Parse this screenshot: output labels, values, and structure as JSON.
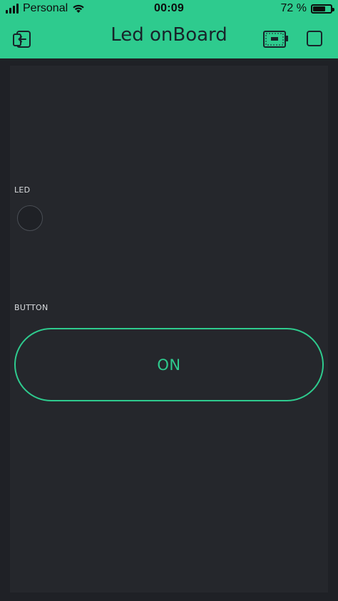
{
  "status_bar": {
    "carrier": "Personal",
    "time": "00:09",
    "battery": "72 %",
    "battery_level": 0.72
  },
  "app_bar": {
    "title": "Led onBoard",
    "back_icon": "exit-arrow-icon",
    "device_icon": "device-board-icon",
    "stop_icon": "stop-square-icon"
  },
  "widgets": {
    "led": {
      "label": "LED",
      "state": "off"
    },
    "button": {
      "label": "BUTTON",
      "text": "ON"
    }
  },
  "colors": {
    "accent": "#2ecb8e",
    "background": "#1f2126",
    "canvas": "#25272c"
  }
}
